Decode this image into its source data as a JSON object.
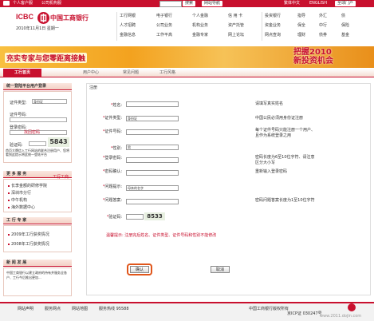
{
  "topbar": {
    "personal_customer": "个人客户服",
    "corporate": "公司机构服",
    "search_button": "搜索",
    "site_nav_button": "网站导航",
    "english": "ENGLISH",
    "site_home_button": "全球门户",
    "neighbour": "繁体中文"
  },
  "header": {
    "logo_latin": "ICBC",
    "logo_mark": "工",
    "logo_text": "中国工商银行",
    "date": "2010年11月1日  星期一",
    "nav_col1": [
      "工行网银",
      "人才招聘",
      "金融信息"
    ],
    "nav_col2": [
      "电子银行",
      "公司业务",
      "工作平高"
    ],
    "nav_col3": [
      "个人金融",
      "机构业务",
      "金融专家"
    ],
    "nav_col4": [
      "信 用 卡",
      "资产托管",
      "网上论坛"
    ],
    "nav_col5": [
      "投资银行",
      "资金业务",
      "网点查询"
    ],
    "nav_col6": [
      "指导",
      "保全",
      "理财"
    ],
    "nav_col7": [
      "外汇",
      "中行",
      "债券"
    ],
    "nav_col8": [
      "债",
      "保险",
      "基金"
    ]
  },
  "banner": {
    "left_text": "充实专家与您零距离接触",
    "right_line1": "把握2010",
    "right_line2": "新投资机会"
  },
  "nav": {
    "home": "工行首页",
    "tabs": [
      "用户中心",
      "常见问题",
      "工行风格"
    ]
  },
  "sidebar": {
    "login_title": "统一登陆平台用户登录",
    "cert_type_label": "证件类型:",
    "cert_type_value": "身份证",
    "cert_no_label": "证件号码:",
    "password_label": "登录密码:",
    "forgot_password": "找回密码",
    "captcha_label": "验证码:",
    "captcha_value": "5843",
    "login_note": "首页大牌信入工行网站的联合注册用户、您将看到此提示将此统一登陆平台",
    "more_title": "更 多 服 务",
    "more_items": [
      "长李金额的研修学院",
      "深圳市分行",
      "中午机构",
      "海外数据中心"
    ],
    "more_right": "工行工商",
    "study_title": "工 行 专 家",
    "study_items": [
      "2009年工行获奖情况",
      "2008年工行获奖情况"
    ],
    "news_title": "新 闻 发 展",
    "news_text": "中国工商银行以建立政府的持有并服务全各户、工行今后推出更加..."
  },
  "main": {
    "breadcrumb": "注册",
    "fields": [
      {
        "label": "姓名:",
        "value": "",
        "hint": "请填写真实姓名"
      },
      {
        "label": "证件类型:",
        "value": "身份证",
        "hint": "中国公民必须用身份证注册"
      },
      {
        "label": "证件号码:",
        "value": "",
        "hint": "每个证件号码只能注册一个用户、且作为系统登录之用"
      },
      {
        "label": "性别:",
        "value": "男",
        "hint": ""
      },
      {
        "label": "登录密码:",
        "value": "",
        "hint": "密码长度为6至10位字符、请注意区分大小写"
      },
      {
        "label": "密码确认:",
        "value": "",
        "hint": "重新输入登录密码"
      },
      {
        "label": "问题提示:",
        "value": "母亲的名字",
        "hint": ""
      },
      {
        "label": "问题答案:",
        "value": "",
        "hint": "密码问题答案长度为1至10位字符"
      },
      {
        "label": "验证码:",
        "value": "",
        "hint": ""
      }
    ],
    "captcha": "8533",
    "warning": "温馨提示: 注册完后姓名、证件类型、证件号码和性别不能修改",
    "confirm_button": "确认",
    "cancel_button": "取消"
  },
  "footer": {
    "links": [
      "网站声明",
      "服务网点",
      "网站地图",
      "服务热线 95588"
    ],
    "copyright": "中国工商银行版权所有",
    "icp": "京ICP证 030247号",
    "watermark": "www.2011.dojin.com"
  },
  "colors": {
    "brand_red": "#c8102e",
    "banner_orange": "#f3a21f"
  }
}
